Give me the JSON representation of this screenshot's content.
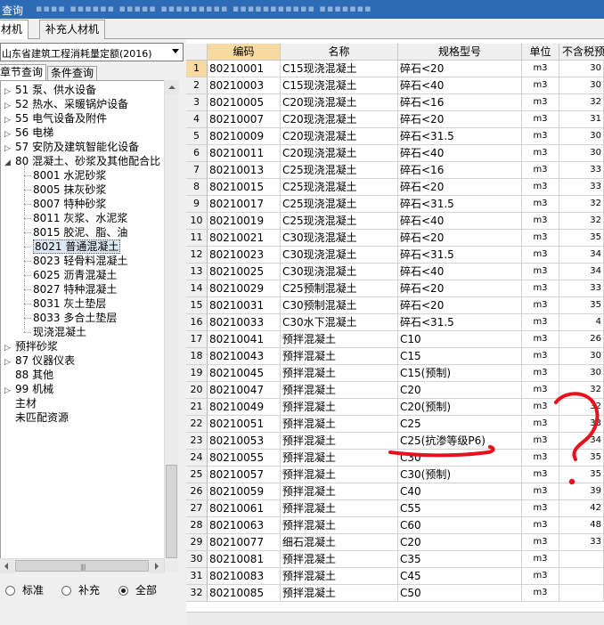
{
  "window": {
    "title_fragment": "查询"
  },
  "tabs": [
    {
      "label": "材机"
    },
    {
      "label": "补充人材机"
    }
  ],
  "left": {
    "quota_select": {
      "value": "山东省建筑工程消耗量定额(2016)"
    },
    "subtabs": [
      {
        "label": "章节查询"
      },
      {
        "label": "条件查询"
      }
    ],
    "tree": [
      {
        "label": "51 泵、供水设备",
        "level": 0,
        "expander": "▷"
      },
      {
        "label": "52 热水、采暖锅炉设备",
        "level": 0,
        "expander": "▷"
      },
      {
        "label": "55 电气设备及附件",
        "level": 0,
        "expander": "▷"
      },
      {
        "label": "56 电梯",
        "level": 0,
        "expander": "▷"
      },
      {
        "label": "57 安防及建筑智能化设备",
        "level": 0,
        "expander": "▷"
      },
      {
        "label": "80 混凝土、砂浆及其他配合比",
        "level": 0,
        "expander": "◢"
      },
      {
        "label": "8001 水泥砂浆",
        "level": 1
      },
      {
        "label": "8005 抹灰砂浆",
        "level": 1
      },
      {
        "label": "8007 特种砂浆",
        "level": 1
      },
      {
        "label": "8011 灰浆、水泥浆",
        "level": 1
      },
      {
        "label": "8015 胶泥、脂、油",
        "level": 1
      },
      {
        "label": "8021 普通混凝土",
        "level": 1,
        "selected": true
      },
      {
        "label": "8023 轻骨料混凝土",
        "level": 1
      },
      {
        "label": "6025 沥青混凝土",
        "level": 1
      },
      {
        "label": "8027 特种混凝土",
        "level": 1
      },
      {
        "label": "8031 灰土垫层",
        "level": 1
      },
      {
        "label": "8033 多合土垫层",
        "level": 1
      },
      {
        "label": "现浇混凝土",
        "level": 1
      },
      {
        "label": "预拌砂浆",
        "level": 0,
        "expander": "▷"
      },
      {
        "label": "87 仪器仪表",
        "level": 0,
        "expander": "▷"
      },
      {
        "label": "88 其他",
        "level": 0
      },
      {
        "label": "99 机械",
        "level": 0,
        "expander": "▷"
      },
      {
        "label": "主材",
        "level": 0
      },
      {
        "label": "未匹配资源",
        "level": 0
      }
    ],
    "radios": [
      {
        "label": "标准",
        "checked": false
      },
      {
        "label": "补充",
        "checked": false
      },
      {
        "label": "全部",
        "checked": true
      }
    ]
  },
  "grid": {
    "columns": [
      "编码",
      "名称",
      "规格型号",
      "单位",
      "不含税预"
    ],
    "rows": [
      {
        "n": "1",
        "code": "80210001",
        "name": "C15现浇混凝土",
        "spec": "碎石<20",
        "unit": "m3",
        "price": "30"
      },
      {
        "n": "2",
        "code": "80210003",
        "name": "C15现浇混凝土",
        "spec": "碎石<40",
        "unit": "m3",
        "price": "30"
      },
      {
        "n": "3",
        "code": "80210005",
        "name": "C20现浇混凝土",
        "spec": "碎石<16",
        "unit": "m3",
        "price": "32"
      },
      {
        "n": "4",
        "code": "80210007",
        "name": "C20现浇混凝土",
        "spec": "碎石<20",
        "unit": "m3",
        "price": "31"
      },
      {
        "n": "5",
        "code": "80210009",
        "name": "C20现浇混凝土",
        "spec": "碎石<31.5",
        "unit": "m3",
        "price": "30"
      },
      {
        "n": "6",
        "code": "80210011",
        "name": "C20现浇混凝土",
        "spec": "碎石<40",
        "unit": "m3",
        "price": "30"
      },
      {
        "n": "7",
        "code": "80210013",
        "name": "C25现浇混凝土",
        "spec": "碎石<16",
        "unit": "m3",
        "price": "33"
      },
      {
        "n": "8",
        "code": "80210015",
        "name": "C25现浇混凝土",
        "spec": "碎石<20",
        "unit": "m3",
        "price": "33"
      },
      {
        "n": "9",
        "code": "80210017",
        "name": "C25现浇混凝土",
        "spec": "碎石<31.5",
        "unit": "m3",
        "price": "32"
      },
      {
        "n": "10",
        "code": "80210019",
        "name": "C25现浇混凝土",
        "spec": "碎石<40",
        "unit": "m3",
        "price": "32"
      },
      {
        "n": "11",
        "code": "80210021",
        "name": "C30现浇混凝土",
        "spec": "碎石<20",
        "unit": "m3",
        "price": "35"
      },
      {
        "n": "12",
        "code": "80210023",
        "name": "C30现浇混凝土",
        "spec": "碎石<31.5",
        "unit": "m3",
        "price": "34"
      },
      {
        "n": "13",
        "code": "80210025",
        "name": "C30现浇混凝土",
        "spec": "碎石<40",
        "unit": "m3",
        "price": "34"
      },
      {
        "n": "14",
        "code": "80210029",
        "name": "C25预制混凝土",
        "spec": "碎石<20",
        "unit": "m3",
        "price": "33"
      },
      {
        "n": "15",
        "code": "80210031",
        "name": "C30预制混凝土",
        "spec": "碎石<20",
        "unit": "m3",
        "price": "35"
      },
      {
        "n": "16",
        "code": "80210033",
        "name": "C30水下混凝土",
        "spec": "碎石<31.5",
        "unit": "m3",
        "price": "4"
      },
      {
        "n": "17",
        "code": "80210041",
        "name": "预拌混凝土",
        "spec": "C10",
        "unit": "m3",
        "price": "26"
      },
      {
        "n": "18",
        "code": "80210043",
        "name": "预拌混凝土",
        "spec": "C15",
        "unit": "m3",
        "price": "30"
      },
      {
        "n": "19",
        "code": "80210045",
        "name": "预拌混凝土",
        "spec": "C15(预制)",
        "unit": "m3",
        "price": "30"
      },
      {
        "n": "20",
        "code": "80210047",
        "name": "预拌混凝土",
        "spec": "C20",
        "unit": "m3",
        "price": "32"
      },
      {
        "n": "21",
        "code": "80210049",
        "name": "预拌混凝土",
        "spec": "C20(预制)",
        "unit": "m3",
        "price": "32"
      },
      {
        "n": "22",
        "code": "80210051",
        "name": "预拌混凝土",
        "spec": "C25",
        "unit": "m3",
        "price": "33"
      },
      {
        "n": "23",
        "code": "80210053",
        "name": "预拌混凝土",
        "spec": "C25(抗渗等级P6)",
        "unit": "m3",
        "price": "34"
      },
      {
        "n": "24",
        "code": "80210055",
        "name": "预拌混凝土",
        "spec": "C30",
        "unit": "m3",
        "price": "35"
      },
      {
        "n": "25",
        "code": "80210057",
        "name": "预拌混凝土",
        "spec": "C30(预制)",
        "unit": "m3",
        "price": "35"
      },
      {
        "n": "26",
        "code": "80210059",
        "name": "预拌混凝土",
        "spec": "C40",
        "unit": "m3",
        "price": "39"
      },
      {
        "n": "27",
        "code": "80210061",
        "name": "预拌混凝土",
        "spec": "C55",
        "unit": "m3",
        "price": "42"
      },
      {
        "n": "28",
        "code": "80210063",
        "name": "预拌混凝土",
        "spec": "C60",
        "unit": "m3",
        "price": "48"
      },
      {
        "n": "29",
        "code": "80210077",
        "name": "细石混凝土",
        "spec": "C20",
        "unit": "m3",
        "price": "33"
      },
      {
        "n": "30",
        "code": "80210081",
        "name": "预拌混凝土",
        "spec": "C35",
        "unit": "m3",
        "price": ""
      },
      {
        "n": "31",
        "code": "80210083",
        "name": "预拌混凝土",
        "spec": "C45",
        "unit": "m3",
        "price": ""
      },
      {
        "n": "32",
        "code": "80210085",
        "name": "预拌混凝土",
        "spec": "C50",
        "unit": "m3",
        "price": ""
      }
    ]
  },
  "colors": {
    "header_active": "#f7d9a2",
    "annotation": "#e8101a",
    "titlebar": "#2d6bb5"
  }
}
